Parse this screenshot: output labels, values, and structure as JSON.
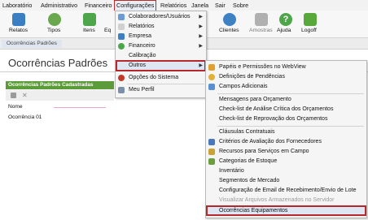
{
  "menubar": {
    "items": [
      "Laboratório",
      "Administrativo",
      "Financeiro",
      "Configurações",
      "Relatórios",
      "Janela",
      "Sair",
      "Sobre"
    ]
  },
  "toolbar": {
    "buttons": [
      "Relatos",
      "Tipos",
      "Itens",
      "Eq",
      "Clientes",
      "Amostras",
      "Ajuda",
      "Logoff"
    ]
  },
  "tab": {
    "label": "Ocorrências Padrões"
  },
  "page": {
    "title": "Ocorrências Padrões",
    "panel_title": "Ocorrências Padrões Cadastradas",
    "field_label": "Nome",
    "list_item": "Ocorrência 01"
  },
  "config_menu": {
    "items": [
      "Colaboradores/Usuários",
      "Relatórios",
      "Empresa",
      "Financeiro",
      "Calibração",
      "Outros",
      "Opções do Sistema",
      "Meu Perfil"
    ]
  },
  "outros_menu": {
    "items": [
      "Papéis e Permissões no WebView",
      "Definições de Pendências",
      "Campos Adicionais",
      "Mensagens para Orçamento",
      "Check-list de Análise Crítica dos Orçamentos",
      "Check-list de Reprovação dos Orçamentos",
      "Cláusulas Contratuais",
      "Critérios de Avaliação dos Fornecedores",
      "Recursos para Serviços em Campo",
      "Categorias de Estoque",
      "Inventário",
      "Segmentos de Mercado",
      "Configuração de Email de Recebimento/Envio de Lote",
      "Visualizar Arquivos Armazenados no Servidor",
      "Ocorrências Equipamentos"
    ]
  },
  "colors": {
    "highlight": "#b7282a",
    "panel_green": "#5c9b3a"
  }
}
